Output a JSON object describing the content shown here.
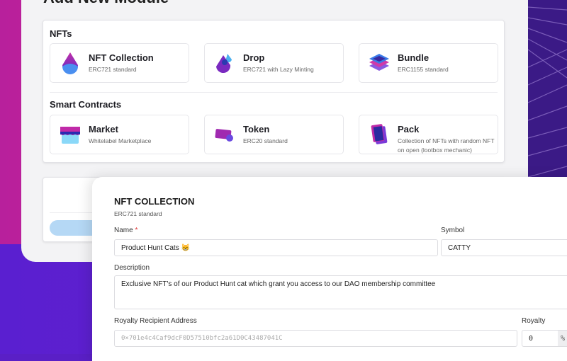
{
  "page_title": "Add New Module",
  "sections": [
    {
      "title": "NFTs",
      "modules": [
        {
          "name": "NFT Collection",
          "desc": "ERC721 standard"
        },
        {
          "name": "Drop",
          "desc": "ERC721 with Lazy Minting"
        },
        {
          "name": "Bundle",
          "desc": "ERC1155 standard"
        }
      ]
    },
    {
      "title": "Smart Contracts",
      "modules": [
        {
          "name": "Market",
          "desc": "Whitelabel Marketplace"
        },
        {
          "name": "Token",
          "desc": "ERC20 standard"
        },
        {
          "name": "Pack",
          "desc": "Collection of NFTs with random NFT on open (lootbox mechanic)"
        }
      ]
    }
  ],
  "form": {
    "title": "NFT COLLECTION",
    "subtitle": "ERC721 standard",
    "name_label": "Name",
    "required_mark": "*",
    "name_value": "Product Hunt Cats 😸",
    "symbol_label": "Symbol",
    "symbol_value": "CATTY",
    "description_label": "Description",
    "description_value": "Exclusive NFT's of our Product Hunt cat which grant you access to our DAO membership committee",
    "royalty_address_label": "Royalty Recipient Address",
    "royalty_address_placeholder": "0×701e4c4Caf9dcF0D57510bfc2a61D0C43487041C",
    "royalty_label": "Royalty",
    "royalty_value": "0",
    "royalty_suffix": "%"
  }
}
